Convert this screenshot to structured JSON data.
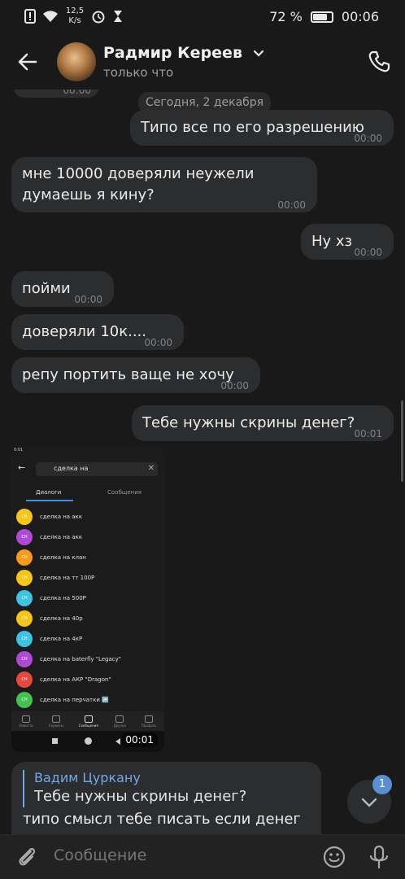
{
  "status_bar": {
    "net_speed": "12,5",
    "net_unit": "K/s",
    "battery": "72 %",
    "battery_level": 0.72,
    "time": "00:06"
  },
  "header": {
    "name": "Радмир Кереев",
    "status": "только что"
  },
  "messages": {
    "partial_time": "00:00",
    "date_divider": "Сегодня, 2 декабря",
    "items": [
      {
        "text": "Типо все по его разрешению",
        "time": "00:00",
        "side": "right"
      },
      {
        "text": "мне 10000 доверяли неужели думаешь я кину?",
        "time": "00:00",
        "side": "left"
      },
      {
        "text": "Ну хз",
        "time": "00:00",
        "side": "right"
      },
      {
        "text": "пойми",
        "time": "00:00",
        "side": "left"
      },
      {
        "text": "доверяли 10к....",
        "time": "00:00",
        "side": "left"
      },
      {
        "text": "репу портить ваще не хочу",
        "time": "00:00",
        "side": "left"
      },
      {
        "text": "Тебе нужны скрины денег?",
        "time": "00:01",
        "side": "right"
      }
    ]
  },
  "screenshot": {
    "status_time": "0:01",
    "search_value": "сделка на",
    "tab_dialogs": "Диалоги",
    "tab_messages": "Сообщения",
    "avatar_label": "СН",
    "results": [
      {
        "label": "сделка на акк",
        "color": "#f5c518"
      },
      {
        "label": "сделка на акк",
        "color": "#b04ad6"
      },
      {
        "label": "сделка на клан",
        "color": "#f59a1a"
      },
      {
        "label": "сделка на тт 100Р",
        "color": "#f5c518"
      },
      {
        "label": "сделка на 500Р",
        "color": "#3cc4e0"
      },
      {
        "label": "сделка на 40р",
        "color": "#f5c518"
      },
      {
        "label": "сделка на 4кР",
        "color": "#3cc4e0"
      },
      {
        "label": "сделка на baterfly \"Legacy\"",
        "color": "#b04ad6"
      },
      {
        "label": "сделка на АКР \"Dragon\"",
        "color": "#e8483c"
      },
      {
        "label": "сделка на перчатки 🆙",
        "color": "#43c24f"
      }
    ],
    "nav": [
      "Новости",
      "Сервисы",
      "Сообщения",
      "Друзья",
      "Профиль"
    ],
    "nav_badge": "1",
    "time": "00:01"
  },
  "reply": {
    "author": "Вадим Цуркану",
    "quoted": "Тебе нужны скрины денег?",
    "text": "типо смысл тебе писать если денег нет"
  },
  "scroll_badge": "1",
  "composer": {
    "placeholder": "Сообщение"
  }
}
